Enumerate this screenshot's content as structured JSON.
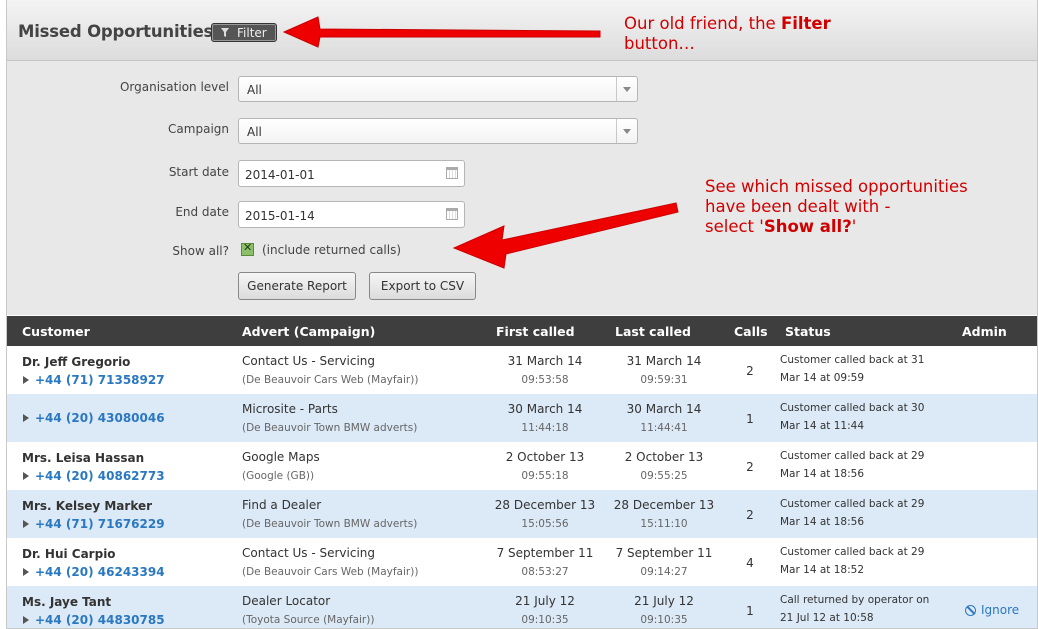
{
  "header": {
    "title": "Missed Opportunities",
    "filter_label": "Filter"
  },
  "filters": {
    "org_level": {
      "label": "Organisation level",
      "value": "All"
    },
    "campaign": {
      "label": "Campaign",
      "value": "All"
    },
    "start_date": {
      "label": "Start date",
      "value": "2014-01-01"
    },
    "end_date": {
      "label": "End date",
      "value": "2015-01-14"
    },
    "show_all": {
      "label": "Show all?",
      "checkbox_text": "(include returned calls)",
      "checked": true
    },
    "generate_label": "Generate Report",
    "export_label": "Export to CSV"
  },
  "table": {
    "columns": [
      "Customer",
      "Advert (Campaign)",
      "First called",
      "Last called",
      "Calls",
      "Status",
      "Admin"
    ],
    "rows": [
      {
        "name": "Dr. Jeff Gregorio",
        "phone": "+44 (71) 71358927",
        "advert": "Contact Us - Servicing",
        "campaign": "(De Beauvoir Cars Web (Mayfair))",
        "first_date": "31 March 14",
        "first_time": "09:53:58",
        "last_date": "31 March 14",
        "last_time": "09:59:31",
        "calls": "2",
        "status": "Customer called back at 31 Mar 14 at 09:59",
        "admin": ""
      },
      {
        "name": "",
        "phone": "+44 (20) 43080046",
        "advert": "Microsite - Parts",
        "campaign": "(De Beauvoir Town BMW adverts)",
        "first_date": "30 March 14",
        "first_time": "11:44:18",
        "last_date": "30 March 14",
        "last_time": "11:44:41",
        "calls": "1",
        "status": "Customer called back at 30 Mar 14 at 11:44",
        "admin": ""
      },
      {
        "name": "Mrs. Leisa Hassan",
        "phone": "+44 (20) 40862773",
        "advert": "Google Maps",
        "campaign": "(Google (GB))",
        "first_date": "2 October 13",
        "first_time": "09:55:18",
        "last_date": "2 October 13",
        "last_time": "09:55:25",
        "calls": "2",
        "status": "Customer called back at 29 Mar 14 at 18:56",
        "admin": ""
      },
      {
        "name": "Mrs. Kelsey Marker",
        "phone": "+44 (71) 71676229",
        "advert": "Find a Dealer",
        "campaign": "(De Beauvoir Town BMW adverts)",
        "first_date": "28 December 13",
        "first_time": "15:05:56",
        "last_date": "28 December 13",
        "last_time": "15:11:10",
        "calls": "2",
        "status": "Customer called back at 29 Mar 14 at 18:56",
        "admin": ""
      },
      {
        "name": "Dr. Hui Carpio",
        "phone": "+44 (20) 46243394",
        "advert": "Contact Us - Servicing",
        "campaign": "(De Beauvoir Cars Web (Mayfair))",
        "first_date": "7 September 11",
        "first_time": "08:53:27",
        "last_date": "7 September 11",
        "last_time": "09:14:27",
        "calls": "4",
        "status": "Customer called back at 29 Mar 14 at 18:52",
        "admin": ""
      },
      {
        "name": "Ms. Jaye Tant",
        "phone": "+44 (20) 44830785",
        "advert": "Dealer Locator",
        "campaign": "(Toyota Source (Mayfair))",
        "first_date": "21 July 12",
        "first_time": "09:10:35",
        "last_date": "21 July 12",
        "last_time": "09:10:35",
        "calls": "1",
        "status": "Call returned by operator on 21 Jul 12 at 10:58",
        "admin": "Ignore"
      }
    ]
  },
  "annotations": {
    "filter_note_pre": "Our old friend, the ",
    "filter_note_bold": "Filter",
    "filter_note_post": "button…",
    "showall_note_line1": "See which missed opportunities",
    "showall_note_line2": "have been dealt with -",
    "showall_note_pre": "select '",
    "showall_note_bold": "Show all?",
    "showall_note_post": "'"
  },
  "colors": {
    "annotation_red": "#d10000",
    "link_blue": "#2a78c2",
    "row_alt": "#dce9f6",
    "header_dark": "#3e3e3e"
  }
}
